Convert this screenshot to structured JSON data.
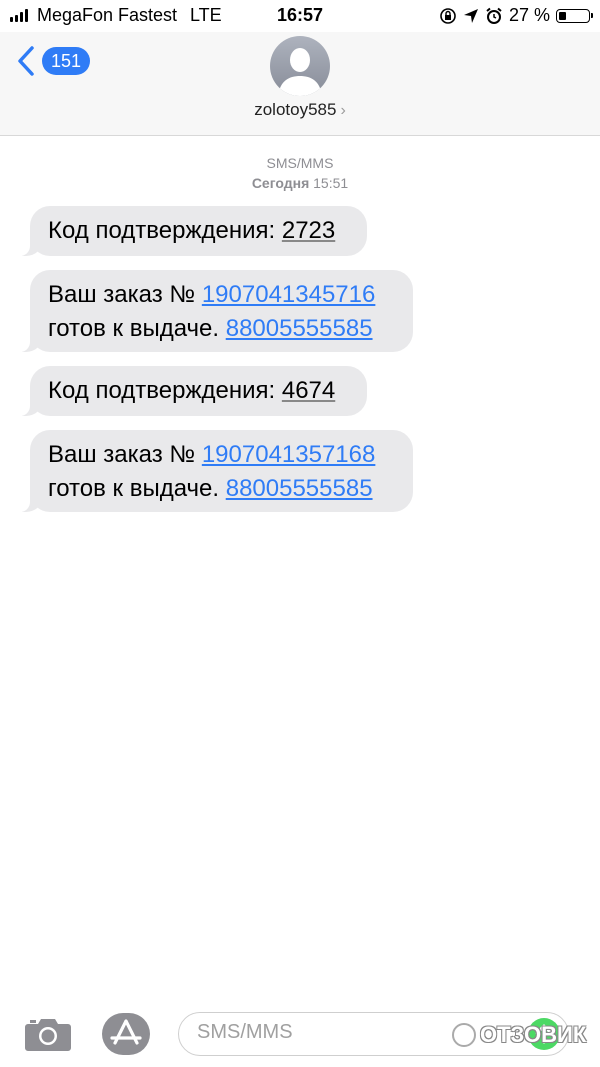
{
  "status_bar": {
    "carrier": "MegaFon Fastest",
    "network": "LTE",
    "time": "16:57",
    "battery": "27 %",
    "battery_level": 0.27,
    "icons": [
      "orientation-lock-icon",
      "location-icon",
      "alarm-icon",
      "battery-icon"
    ]
  },
  "header": {
    "back_count": "151",
    "contact_name": "zolotoy585",
    "chevron": "›",
    "accent_color": "#2f7cf6"
  },
  "thread": {
    "service": "SMS/MMS",
    "date_label": "Сегодня",
    "date_time": "15:51"
  },
  "messages": [
    {
      "prefix": "Код подтверждения: ",
      "code": "2723"
    },
    {
      "line1_prefix": "Ваш заказ № ",
      "order": "1907041345716",
      "line2_prefix": "готов к выдаче. ",
      "phone": "88005555585"
    },
    {
      "prefix": "Код подтверждения: ",
      "code": "4674"
    },
    {
      "line1_prefix": "Ваш заказ № ",
      "order": "1907041357168",
      "line2_prefix": "готов к выдаче. ",
      "phone": "88005555585"
    }
  ],
  "composer": {
    "placeholder": "SMS/MMS",
    "send_color": "#4cd964"
  },
  "watermark": {
    "text": "ОТЗОВИК"
  }
}
